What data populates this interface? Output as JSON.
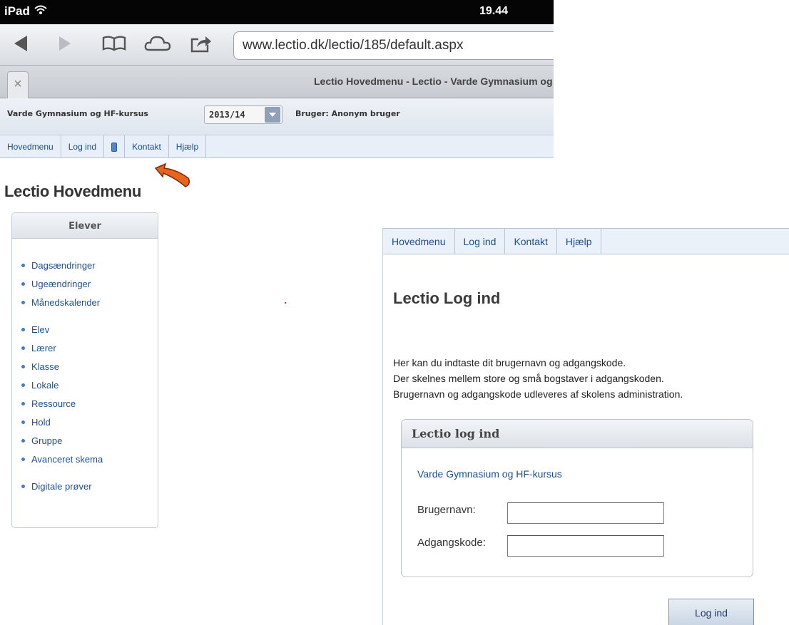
{
  "statusbar": {
    "device": "iPad",
    "time": "19.44"
  },
  "browser": {
    "url": "www.lectio.dk/lectio/185/default.aspx",
    "tab_close": "×",
    "tab_title": "Lectio Hovedmenu - Lectio - Varde Gymnasium og HF-kursus"
  },
  "lectio_header": {
    "school": "Varde Gymnasium og HF-kursus",
    "year": "2013/14",
    "user": "Bruger: Anonym bruger"
  },
  "ipad_nav": {
    "items": [
      "Hovedmenu",
      "Log ind",
      "Kontakt",
      "Hjælp"
    ],
    "mobile_icon": "mobile-icon"
  },
  "hoved": {
    "title": "Lectio Hovedmenu",
    "box_title": "Elever",
    "links": [
      "Dagsændringer",
      "Ugeændringer",
      "Månedskalender",
      "Elev",
      "Lærer",
      "Klasse",
      "Lokale",
      "Ressource",
      "Hold",
      "Gruppe",
      "Avanceret skema",
      "Digitale prøver"
    ]
  },
  "login": {
    "nav": [
      "Hovedmenu",
      "Log ind",
      "Kontakt",
      "Hjælp"
    ],
    "title": "Lectio Log ind",
    "intro": [
      "Her kan du indtaste dit brugernavn og adgangskode.",
      "Der skelnes mellem store og små bogstaver i adgangskoden.",
      "Brugernavn og adgangskode udleveres af skolens administration."
    ],
    "box_title": "Lectio log ind",
    "school": "Varde Gymnasium og HF-kursus",
    "username_label": "Brugernavn:",
    "password_label": "Adgangskode:",
    "username_value": "",
    "password_value": "",
    "button": "Log ind"
  },
  "colors": {
    "link": "#1f4f8f",
    "nav_bg": "#e8eff8",
    "arrow": "#e8641e"
  }
}
